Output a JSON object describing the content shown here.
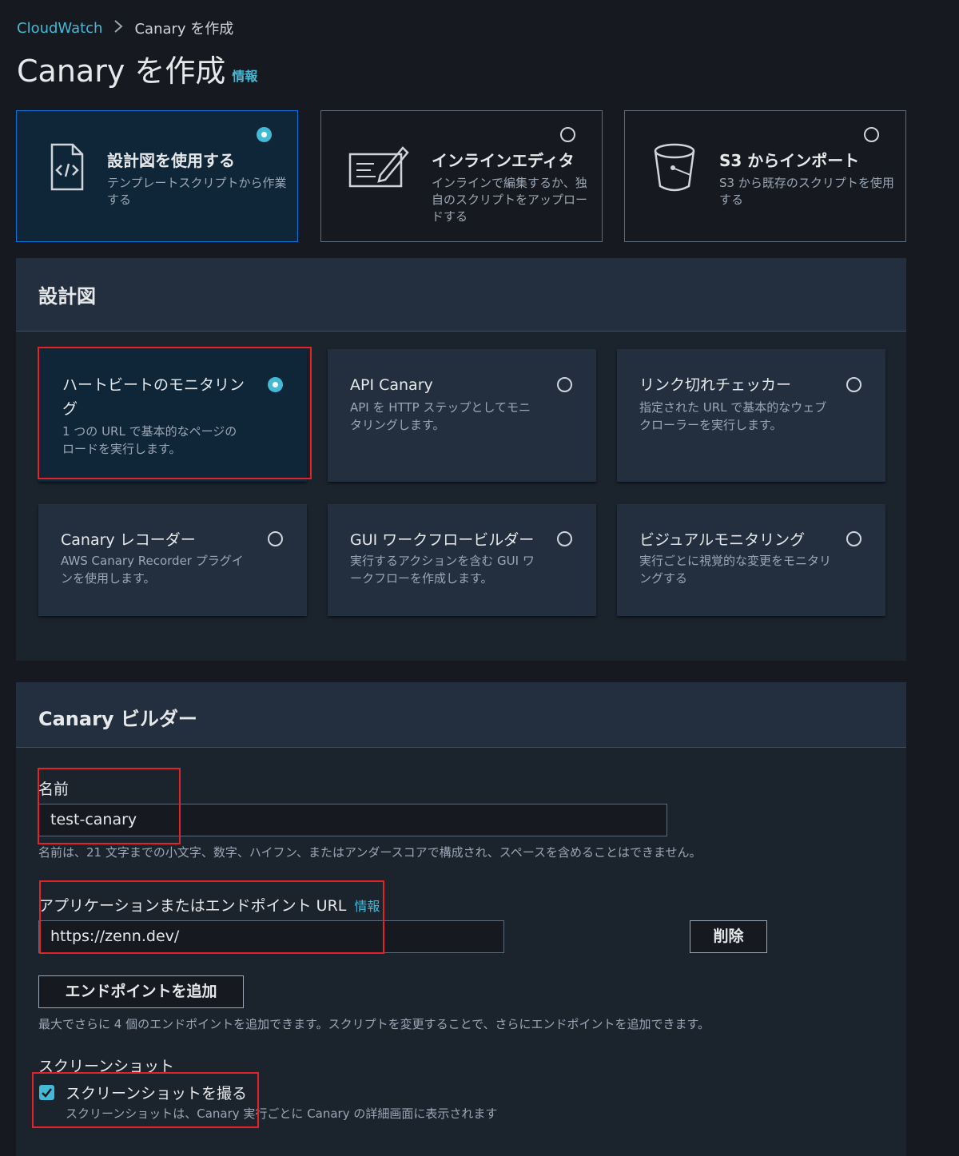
{
  "breadcrumb": {
    "root": "CloudWatch",
    "current": "Canary を作成"
  },
  "page": {
    "title": "Canary を作成",
    "info": "情報"
  },
  "source_tiles": [
    {
      "title": "設計図を使用する",
      "desc": "テンプレートスクリプトから作業する",
      "selected": true
    },
    {
      "title": "インラインエディタ",
      "desc": "インラインで編集するか、独自のスクリプトをアップロードする",
      "selected": false
    },
    {
      "title": "S3 からインポート",
      "desc": "S3 から既存のスクリプトを使用する",
      "selected": false
    }
  ],
  "blueprints": {
    "header": "設計図",
    "items": [
      {
        "title": "ハートビートのモニタリング",
        "desc": "1 つの URL で基本的なページのロードを実行します。",
        "selected": true
      },
      {
        "title": "API Canary",
        "desc": "API を HTTP ステップとしてモニタリングします。",
        "selected": false
      },
      {
        "title": "リンク切れチェッカー",
        "desc": "指定された URL で基本的なウェブクローラーを実行します。",
        "selected": false
      },
      {
        "title": "Canary レコーダー",
        "desc": "AWS Canary Recorder プラグインを使用します。",
        "selected": false
      },
      {
        "title": "GUI ワークフロービルダー",
        "desc": "実行するアクションを含む GUI ワークフローを作成します。",
        "selected": false
      },
      {
        "title": "ビジュアルモニタリング",
        "desc": "実行ごとに視覚的な変更をモニタリングする",
        "selected": false
      }
    ]
  },
  "builder": {
    "header": "Canary ビルダー",
    "name_label": "名前",
    "name_value": "test-canary",
    "name_hint": "名前は、21 文字までの小文字、数字、ハイフン、またはアンダースコアで構成され、スペースを含めることはできません。",
    "url_label": "アプリケーションまたはエンドポイント URL",
    "url_info": "情報",
    "url_value": "https://zenn.dev/",
    "remove_button": "削除",
    "add_endpoint_button": "エンドポイントを追加",
    "endpoint_hint": "最大でさらに 4 個のエンドポイントを追加できます。スクリプトを変更することで、さらにエンドポイントを追加できます。",
    "screenshot_label": "スクリーンショット",
    "screenshot_checkbox": "スクリーンショットを撮る",
    "screenshot_checked": true,
    "screenshot_hint": "スクリーンショットは、Canary 実行ごとに Canary の詳細画面に表示されます"
  },
  "colors": {
    "accent": "#44b9d6",
    "selected_bg": "#0f2538",
    "annotation_red": "#e2232a"
  }
}
